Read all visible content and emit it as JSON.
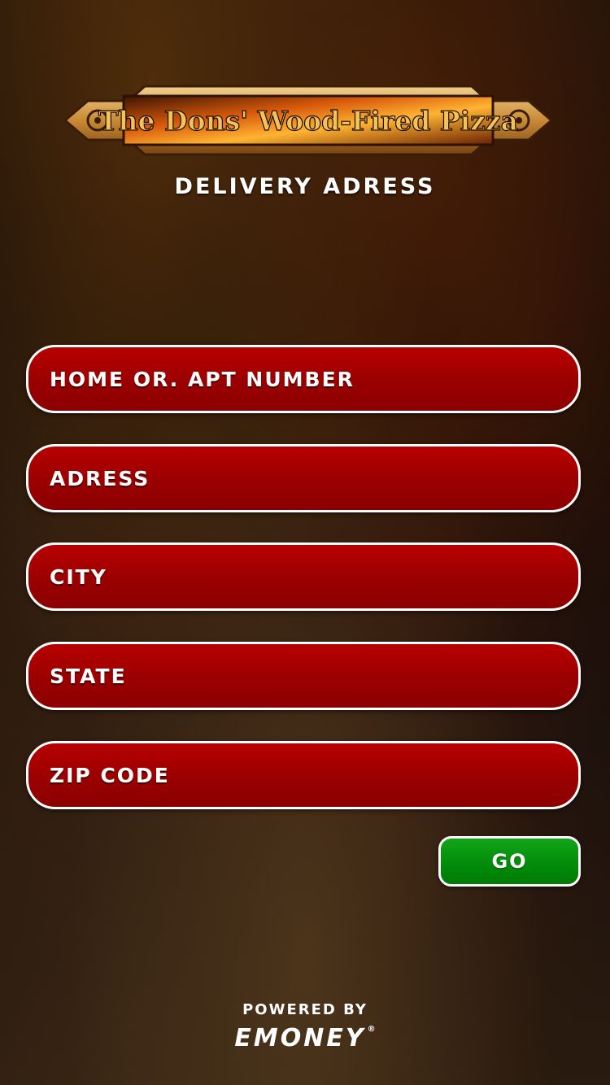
{
  "logo": {
    "text": "The Dons' Wood-Fired Pizza"
  },
  "page": {
    "title": "DELIVERY ADRESS"
  },
  "form": {
    "fields": [
      {
        "placeholder": "HOME OR. APT NUMBER"
      },
      {
        "placeholder": "ADRESS"
      },
      {
        "placeholder": "CITY"
      },
      {
        "placeholder": "STATE"
      },
      {
        "placeholder": "ZIP CODE"
      }
    ],
    "go_label": "GO"
  },
  "footer": {
    "powered_by": "POWERED BY",
    "brand": "EMONEY",
    "registered_mark": "®"
  },
  "colors": {
    "field_red": "#9a0000",
    "button_green": "#008a08",
    "text_white": "#ffffff"
  }
}
